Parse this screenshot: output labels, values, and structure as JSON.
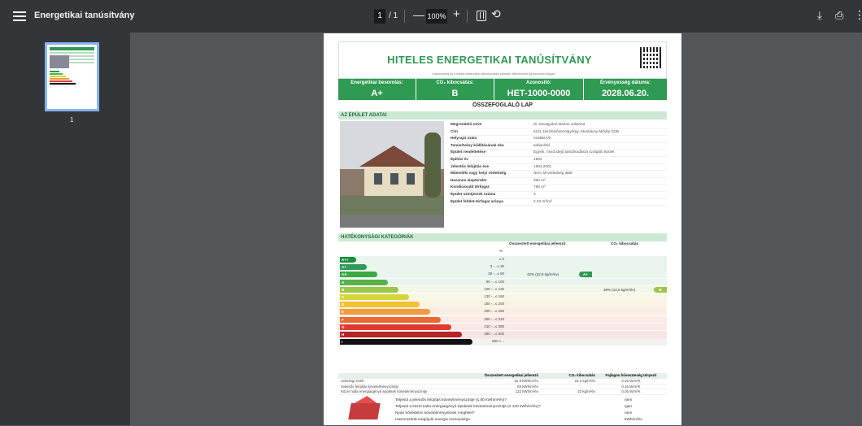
{
  "toolbar": {
    "title": "Energetikai tanúsítvány",
    "page_current": "1",
    "page_total": "/ 1",
    "zoom": "100%",
    "icons": [
      "menu-icon",
      "zoom-out-icon",
      "zoom-in-icon",
      "fit-page-icon",
      "rotate-icon",
      "download-icon",
      "print-icon",
      "more-icon"
    ]
  },
  "sidebar": {
    "thumb_label": "1"
  },
  "doc": {
    "title": "HITELES ENERGETIKAI TANÚSÍTVÁNY",
    "subtitle": "A tanúsítvány az e-hiteles elektronikus állományában szerepel, ellenőrizhető az azonosító alapján",
    "labels": [
      "Energetikai besorolás:",
      "CO₂ kibocsátás:",
      "Azonosító:",
      "Érvényesség dátuma:"
    ],
    "values": [
      "A+",
      "B",
      "HET-1000-0000",
      "2028.06.20."
    ],
    "summary": "ÖSSZEFOGLALÓ LAP",
    "section_building": "AZ ÉPÜLET ADATAI",
    "building_rows": [
      {
        "k": "Megrendelő neve",
        "v": "dr. Zavagyáné Bartos Julianna"
      },
      {
        "k": "Cím",
        "v": "5111 Jászfelsőszentgyörgy, Munkácsy Mihály 22/B."
      },
      {
        "k": "Helyrajzi szám",
        "v": "01586/A/0"
      },
      {
        "k": "Tanúsítvány kiállításának oka",
        "v": "adásvétel"
      },
      {
        "k": "Épület rendeltetése",
        "v": "Egyéb, rövid idejű tartózkodásra szolgáló épület"
      },
      {
        "k": "Építési év",
        "v": "1983"
      },
      {
        "k": "Jelentős felújítás éve",
        "v": "1993,2001"
      },
      {
        "k": "Műemléki vagy helyi védettség",
        "v": "Nem áll védettség alatt"
      },
      {
        "k": "Hasznos alapterület",
        "v": "369 m²"
      },
      {
        "k": "Kondicionált térfogat",
        "v": "798 m³"
      },
      {
        "k": "Épület szintjeinek száma",
        "v": "3"
      },
      {
        "k": "Épület felület-térfogat aránya",
        "v": "2.33 m²/m³"
      }
    ],
    "section_eff": "HATÉKONYSÁGI KATEGÓRIÁK",
    "eff_cols": [
      "Összesített energetikai jellemző",
      "CO₂ kibocsátás"
    ],
    "percent": "%",
    "bands": [
      {
        "label": "A++",
        "range": "≤ 0",
        "color": "#1a8f3e"
      },
      {
        "label": "A+",
        "range": "0 -...≤ 30",
        "color": "#2e9a52"
      },
      {
        "label": "AA",
        "range": "30 -...≤ 90",
        "color": "#3aa845"
      },
      {
        "label": "A",
        "range": "90 -...≤ 100",
        "color": "#57b348"
      },
      {
        "label": "B",
        "range": "100 -...≤ 130",
        "color": "#9cc64a"
      },
      {
        "label": "C",
        "range": "130 -...≤ 160",
        "color": "#d5d43a"
      },
      {
        "label": "D",
        "range": "160 -...≤ 200",
        "color": "#f2c135"
      },
      {
        "label": "E",
        "range": "200 -...≤ 250",
        "color": "#f19b3c"
      },
      {
        "label": "F",
        "range": "250 -...≤ 310",
        "color": "#ea6a33"
      },
      {
        "label": "G",
        "range": "310 -...≤ 390",
        "color": "#de3a2f"
      },
      {
        "label": "H",
        "range": "390 -...≤ 500",
        "color": "#b42626"
      },
      {
        "label": "I",
        "range": "500 <...",
        "color": "#111111"
      }
    ],
    "energy_mark": "42% (32,9 kg/m²év)",
    "energy_mark_label": "A+",
    "co2_mark": "38% (12,8 kg/m²év)",
    "co2_mark_label": "B",
    "table_head": [
      "",
      "Összesített energetikai jellemző",
      "CO₂ kibocsátás",
      "Fajlagos hőveszteség tényező"
    ],
    "table_rows": [
      [
        "Jelenlegi érték",
        "32.9 kWh/m²év",
        "23.2 kg/m²év",
        "0.25 W/m³K"
      ],
      [
        "Jelentős felújítás követelményszintje",
        "83 kWh/m²év",
        "",
        "0.15 W/m³K"
      ],
      [
        "Közel nulla energiaigényű épületek követelményszintje",
        "122 kWh/m²év",
        "23 kg/m²év",
        "0.05 W/m³K"
      ]
    ],
    "questions": [
      {
        "q": "Teljesül a jelentős felújítás követelményszintje (≤ 80 kWh/m²év)?",
        "a": "nem"
      },
      {
        "q": "Teljesül a közel nulla energiaigényű épületek követelményszintje (≤ 120 kWh/m²év)?",
        "a": "igen"
      },
      {
        "q": "Nyári hővédelmi követelményeknek megfelel?",
        "a": "nem"
      },
      {
        "q": "Hasznosított megújuló energia mennyisége",
        "a": "kWh/m²év"
      }
    ]
  }
}
